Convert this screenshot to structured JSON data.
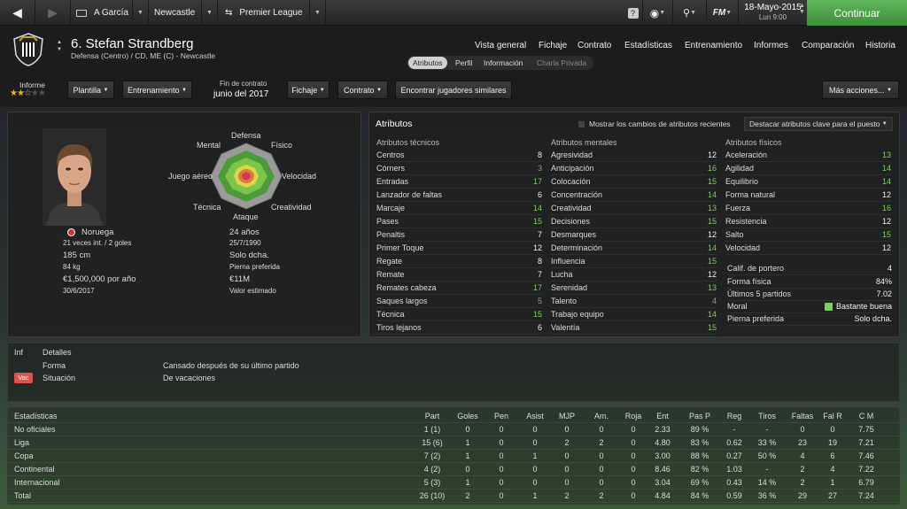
{
  "topbar": {
    "manager": "A García",
    "club": "Newcastle",
    "competition": "Premier League",
    "fm_label": "FM",
    "date": "18-Mayo-2015",
    "day": "Lun 9:00",
    "continue": "Continuar"
  },
  "player": {
    "title": "6. Stefan Strandberg",
    "subtitle": "Defensa (Centro) / CD, ME (C) - Newcastle"
  },
  "nav": [
    "Vista general",
    "Fichaje",
    "Contrato",
    "Estadísticas",
    "Entrenamiento",
    "Informes",
    "Comparación",
    "Historia"
  ],
  "subtabs": [
    "Atributos",
    "Perfil",
    "Información",
    "Charla Privada"
  ],
  "informe": {
    "label": "Informe"
  },
  "buttons": {
    "plantilla": "Plantilla",
    "entrenamiento": "Entrenamiento",
    "contract_label": "Fin de contrato",
    "contract_value": "junio del 2017",
    "fichaje": "Fichaje",
    "contrato": "Contrato",
    "similares": "Encontrar jugadores similares",
    "mas": "Más acciones..."
  },
  "profile": {
    "nationality": "Noruega",
    "caps": "21 veces int. / 2 goles",
    "height": "185 cm",
    "weight": "84 kg",
    "wage": "€1,500,000 por año",
    "contract_end": "30/6/2017",
    "age": "24 años",
    "dob": "25/7/1990",
    "foot": "Solo dcha.",
    "foot_label": "Pierna preferida",
    "value": "€11M",
    "value_label": "Valor estimado"
  },
  "radar": {
    "labels": [
      "Defensa",
      "Físico",
      "Velocidad",
      "Creatividad",
      "Ataque",
      "Técnica",
      "Juego aéreo",
      "Mental"
    ]
  },
  "attributes": {
    "title": "Atributos",
    "show_changes": "Mostrar los cambios de atributos recientes",
    "highlight": "Destacar atributos clave para el puesto",
    "tech_title": "Atributos técnicos",
    "mental_title": "Atributos mentales",
    "phys_title": "Atributos físicos",
    "technical": [
      [
        "Centros",
        "8"
      ],
      [
        "Córners",
        "3"
      ],
      [
        "Entradas",
        "17"
      ],
      [
        "Lanzador de faltas",
        "6"
      ],
      [
        "Marcaje",
        "14"
      ],
      [
        "Pases",
        "15"
      ],
      [
        "Penaltis",
        "7"
      ],
      [
        "Primer Toque",
        "12"
      ],
      [
        "Regate",
        "8"
      ],
      [
        "Remate",
        "7"
      ],
      [
        "Remates cabeza",
        "17"
      ],
      [
        "Saques largos",
        "5"
      ],
      [
        "Técnica",
        "15"
      ],
      [
        "Tiros lejanos",
        "6"
      ]
    ],
    "mental": [
      [
        "Agresividad",
        "12"
      ],
      [
        "Anticipación",
        "16"
      ],
      [
        "Colocación",
        "15"
      ],
      [
        "Concentración",
        "14"
      ],
      [
        "Creatividad",
        "13"
      ],
      [
        "Decisiones",
        "15"
      ],
      [
        "Desmarques",
        "12"
      ],
      [
        "Determinación",
        "14"
      ],
      [
        "Influencia",
        "15"
      ],
      [
        "Lucha",
        "12"
      ],
      [
        "Serenidad",
        "13"
      ],
      [
        "Talento",
        "4"
      ],
      [
        "Trabajo equipo",
        "14"
      ],
      [
        "Valentía",
        "15"
      ]
    ],
    "physical": [
      [
        "Aceleración",
        "13"
      ],
      [
        "Agilidad",
        "14"
      ],
      [
        "Equilibrio",
        "14"
      ],
      [
        "Forma natural",
        "12"
      ],
      [
        "Fuerza",
        "16"
      ],
      [
        "Resistencia",
        "12"
      ],
      [
        "Salto",
        "15"
      ],
      [
        "Velocidad",
        "12"
      ]
    ],
    "extra": [
      [
        "Calif. de portero",
        "4"
      ],
      [
        "Forma física",
        "84%"
      ],
      [
        "Últimos 5 partidos",
        "7.02"
      ],
      [
        "Moral",
        "Bastante buena"
      ],
      [
        "Pierna preferida",
        "Solo dcha."
      ]
    ]
  },
  "details": {
    "col1": "Inf",
    "col2": "Detalles",
    "forma_label": "Forma",
    "forma_value": "Cansado después de su último partido",
    "sit_badge": "Vac",
    "sit_label": "Situación",
    "sit_value": "De vacaciones"
  },
  "stats": {
    "headers": [
      "Estadísticas",
      "Part",
      "Goles",
      "Pen",
      "Asist",
      "MJP",
      "Am.",
      "Roja",
      "Ent",
      "Pas P",
      "Reg",
      "Tiros",
      "Faltas",
      "Fal R",
      "C M"
    ],
    "rows": [
      [
        "No oficiales",
        "1 (1)",
        "0",
        "0",
        "0",
        "0",
        "0",
        "0",
        "2.33",
        "89 %",
        "-",
        "-",
        "0",
        "0",
        "7.75"
      ],
      [
        "Liga",
        "15 (6)",
        "1",
        "0",
        "0",
        "2",
        "2",
        "0",
        "4.80",
        "83 %",
        "0.62",
        "33 %",
        "23",
        "19",
        "7.21"
      ],
      [
        "Copa",
        "7 (2)",
        "1",
        "0",
        "1",
        "0",
        "0",
        "0",
        "3.00",
        "88 %",
        "0.27",
        "50 %",
        "4",
        "6",
        "7.46"
      ],
      [
        "Continental",
        "4 (2)",
        "0",
        "0",
        "0",
        "0",
        "0",
        "0",
        "8.46",
        "82 %",
        "1.03",
        "-",
        "2",
        "4",
        "7.22"
      ],
      [
        "Internacional",
        "5 (3)",
        "1",
        "0",
        "0",
        "0",
        "0",
        "0",
        "3.04",
        "69 %",
        "0.43",
        "14 %",
        "2",
        "1",
        "6.79"
      ],
      [
        "Total",
        "26 (10)",
        "2",
        "0",
        "1",
        "2",
        "2",
        "0",
        "4.84",
        "84 %",
        "0.59",
        "36 %",
        "29",
        "27",
        "7.24"
      ]
    ]
  },
  "colors": {
    "accent_green": "#4ea84a",
    "attr_green": "#7fd05a",
    "vac_red": "#d9534f"
  }
}
